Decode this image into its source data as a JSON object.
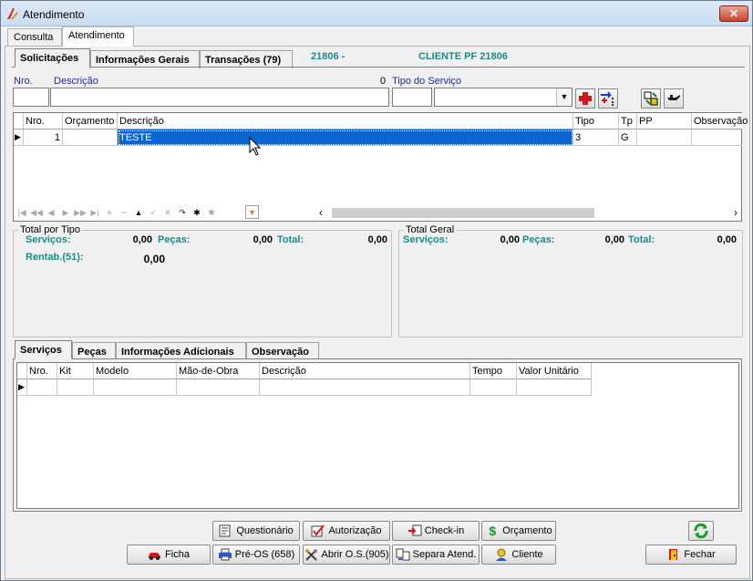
{
  "window": {
    "title": "Atendimento",
    "close_label": "✕"
  },
  "top_tabs": [
    {
      "label": "Consulta"
    },
    {
      "label": "Atendimento"
    }
  ],
  "inner_tabs": [
    {
      "label": "Solicitações"
    },
    {
      "label": "Informações Gerais"
    },
    {
      "label": "Transações (79)"
    }
  ],
  "header_info": {
    "code": "21806 -",
    "client": "CLIENTE PF 21806"
  },
  "form": {
    "nro_label": "Nro.",
    "descricao_label": "Descrição",
    "descricao_count": "0",
    "tipo_label": "Tipo do Serviço",
    "nro_value": "",
    "descricao_value": "",
    "tipo_value": ""
  },
  "solicitacoes_grid": {
    "columns": [
      "Nro.",
      "Orçamento",
      "Descrição",
      "Tipo",
      "Tp",
      "PP",
      "Observação"
    ],
    "rows": [
      {
        "nro": "1",
        "orcamento": "",
        "descricao": "TESTE",
        "tipo": "3",
        "tp": "G",
        "pp": "",
        "observacao": ""
      }
    ]
  },
  "total_tipo": {
    "legend": "Total por Tipo",
    "servicos_label": "Serviços:",
    "servicos_value": "0,00",
    "pecas_label": "Peças:",
    "pecas_value": "0,00",
    "total_label": "Total:",
    "total_value": "0,00",
    "rentab_label": "Rentab.(51):",
    "rentab_value": "0,00"
  },
  "total_geral": {
    "legend": "Total Geral",
    "servicos_label": "Serviços:",
    "servicos_value": "0,00",
    "pecas_label": "Peças:",
    "pecas_value": "0,00",
    "total_label": "Total:",
    "total_value": "0,00"
  },
  "bottom_tabs": [
    {
      "label": "Serviços"
    },
    {
      "label": "Peças"
    },
    {
      "label": "Informações Adicionais"
    },
    {
      "label": "Observação"
    }
  ],
  "servicos_grid": {
    "columns": [
      "Nro.",
      "Kit",
      "Modelo",
      "Mão-de-Obra",
      "Descrição",
      "Tempo",
      "Valor Unitário"
    ]
  },
  "buttons": {
    "questionario": "Questionário",
    "autorizacao": "Autorização",
    "checkin": "Check-in",
    "orcamento": "Orçamento",
    "ficha": "Ficha",
    "preos": "Pré-OS (658)",
    "abrir_os": "Abrir O.S.(905)",
    "separa": "Separa Atend.",
    "cliente": "Cliente",
    "fechar": "Fechar"
  },
  "colors": {
    "accent_teal": "#1c8a8a",
    "label_blue": "#1a2a9c",
    "selection": "#0a64d2"
  }
}
